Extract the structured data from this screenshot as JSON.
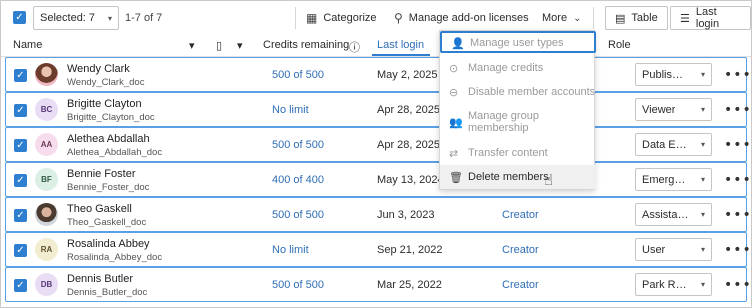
{
  "toolbar": {
    "check_glyph": "✓",
    "selected_label": "Selected: 7",
    "caret_glyph": "▾",
    "count_label": "1-7 of 7",
    "categorize_label": "Categorize",
    "categorize_icon": "▦",
    "addons_label": "Manage add-on licenses",
    "addons_icon": "⚲",
    "more_label": "More",
    "more_caret": "⌄",
    "table_label": "Table",
    "table_icon": "▤",
    "sort_label": "Last login",
    "sort_icon": "☰"
  },
  "header": {
    "name": "Name",
    "name_caret": "▾",
    "device_icon": "▯",
    "device_caret": "▾",
    "credits": "Credits remaining",
    "info_icon": "ⓘ",
    "last_login": "Last login",
    "role": "Role"
  },
  "menu": {
    "items": [
      {
        "label": "Manage user types",
        "icon": "👤"
      },
      {
        "label": "Manage credits",
        "icon": "⊙"
      },
      {
        "label": "Disable member accounts",
        "icon": "⊖"
      },
      {
        "label": "Manage group",
        "label2": "membership",
        "icon": "👥"
      },
      {
        "label": "Transfer content",
        "icon": "⇄"
      },
      {
        "label": "Delete members",
        "icon": "🗑"
      }
    ]
  },
  "rows": [
    {
      "name": "Wendy Clark",
      "username": "Wendy_Clark_doc",
      "initials": "",
      "credits": "500 of 500",
      "last_login": "May 2, 2025",
      "user_type": "",
      "role": "Publis…",
      "check": "✓",
      "more": "•••"
    },
    {
      "name": "Brigitte Clayton",
      "username": "Brigitte_Clayton_doc",
      "initials": "BC",
      "credits": "No limit",
      "last_login": "Apr 28, 2025",
      "user_type": "",
      "role": "Viewer",
      "check": "✓",
      "more": "•••"
    },
    {
      "name": "Alethea Abdallah",
      "username": "Alethea_Abdallah_doc",
      "initials": "AA",
      "credits": "500 of 500",
      "last_login": "Apr 28, 2025",
      "user_type": "",
      "role": "Data E…",
      "check": "✓",
      "more": "•••"
    },
    {
      "name": "Bennie Foster",
      "username": "Bennie_Foster_doc",
      "initials": "BF",
      "credits": "400 of 400",
      "last_login": "May 13, 2024",
      "user_type": "",
      "role": "Emerg…",
      "check": "✓",
      "more": "•••"
    },
    {
      "name": "Theo Gaskell",
      "username": "Theo_Gaskell_doc",
      "initials": "",
      "credits": "500 of 500",
      "last_login": "Jun 3, 2023",
      "user_type": "Creator",
      "role": "Assista…",
      "check": "✓",
      "more": "•••"
    },
    {
      "name": "Rosalinda Abbey",
      "username": "Rosalinda_Abbey_doc",
      "initials": "RA",
      "credits": "No limit",
      "last_login": "Sep 21, 2022",
      "user_type": "Creator",
      "role": "User",
      "check": "✓",
      "more": "•••"
    },
    {
      "name": "Dennis Butler",
      "username": "Dennis_Butler_doc",
      "initials": "DB",
      "credits": "500 of 500",
      "last_login": "Mar 25, 2022",
      "user_type": "Creator",
      "role": "Park R…",
      "check": "✓",
      "more": "•••"
    }
  ],
  "pointer_icon": "☝"
}
